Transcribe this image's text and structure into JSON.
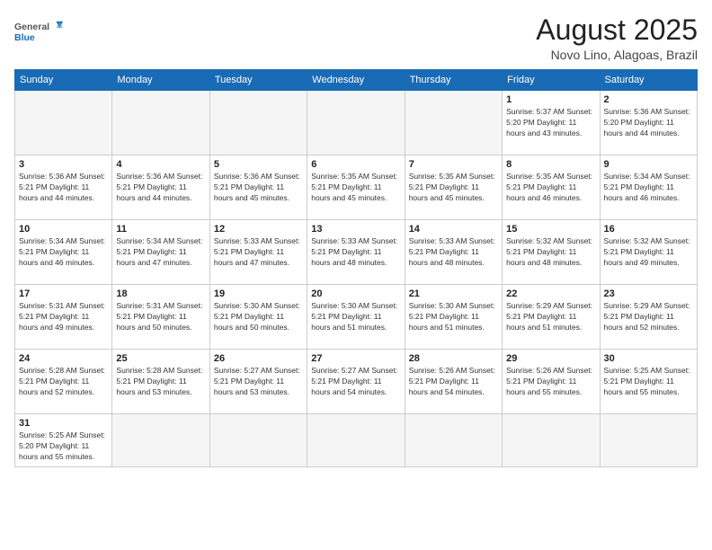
{
  "logo": {
    "text_general": "General",
    "text_blue": "Blue"
  },
  "title": "August 2025",
  "location": "Novo Lino, Alagoas, Brazil",
  "days_of_week": [
    "Sunday",
    "Monday",
    "Tuesday",
    "Wednesday",
    "Thursday",
    "Friday",
    "Saturday"
  ],
  "weeks": [
    [
      {
        "day": "",
        "detail": ""
      },
      {
        "day": "",
        "detail": ""
      },
      {
        "day": "",
        "detail": ""
      },
      {
        "day": "",
        "detail": ""
      },
      {
        "day": "",
        "detail": ""
      },
      {
        "day": "1",
        "detail": "Sunrise: 5:37 AM\nSunset: 5:20 PM\nDaylight: 11 hours\nand 43 minutes."
      },
      {
        "day": "2",
        "detail": "Sunrise: 5:36 AM\nSunset: 5:20 PM\nDaylight: 11 hours\nand 44 minutes."
      }
    ],
    [
      {
        "day": "3",
        "detail": "Sunrise: 5:36 AM\nSunset: 5:21 PM\nDaylight: 11 hours\nand 44 minutes."
      },
      {
        "day": "4",
        "detail": "Sunrise: 5:36 AM\nSunset: 5:21 PM\nDaylight: 11 hours\nand 44 minutes."
      },
      {
        "day": "5",
        "detail": "Sunrise: 5:36 AM\nSunset: 5:21 PM\nDaylight: 11 hours\nand 45 minutes."
      },
      {
        "day": "6",
        "detail": "Sunrise: 5:35 AM\nSunset: 5:21 PM\nDaylight: 11 hours\nand 45 minutes."
      },
      {
        "day": "7",
        "detail": "Sunrise: 5:35 AM\nSunset: 5:21 PM\nDaylight: 11 hours\nand 45 minutes."
      },
      {
        "day": "8",
        "detail": "Sunrise: 5:35 AM\nSunset: 5:21 PM\nDaylight: 11 hours\nand 46 minutes."
      },
      {
        "day": "9",
        "detail": "Sunrise: 5:34 AM\nSunset: 5:21 PM\nDaylight: 11 hours\nand 46 minutes."
      }
    ],
    [
      {
        "day": "10",
        "detail": "Sunrise: 5:34 AM\nSunset: 5:21 PM\nDaylight: 11 hours\nand 46 minutes."
      },
      {
        "day": "11",
        "detail": "Sunrise: 5:34 AM\nSunset: 5:21 PM\nDaylight: 11 hours\nand 47 minutes."
      },
      {
        "day": "12",
        "detail": "Sunrise: 5:33 AM\nSunset: 5:21 PM\nDaylight: 11 hours\nand 47 minutes."
      },
      {
        "day": "13",
        "detail": "Sunrise: 5:33 AM\nSunset: 5:21 PM\nDaylight: 11 hours\nand 48 minutes."
      },
      {
        "day": "14",
        "detail": "Sunrise: 5:33 AM\nSunset: 5:21 PM\nDaylight: 11 hours\nand 48 minutes."
      },
      {
        "day": "15",
        "detail": "Sunrise: 5:32 AM\nSunset: 5:21 PM\nDaylight: 11 hours\nand 48 minutes."
      },
      {
        "day": "16",
        "detail": "Sunrise: 5:32 AM\nSunset: 5:21 PM\nDaylight: 11 hours\nand 49 minutes."
      }
    ],
    [
      {
        "day": "17",
        "detail": "Sunrise: 5:31 AM\nSunset: 5:21 PM\nDaylight: 11 hours\nand 49 minutes."
      },
      {
        "day": "18",
        "detail": "Sunrise: 5:31 AM\nSunset: 5:21 PM\nDaylight: 11 hours\nand 50 minutes."
      },
      {
        "day": "19",
        "detail": "Sunrise: 5:30 AM\nSunset: 5:21 PM\nDaylight: 11 hours\nand 50 minutes."
      },
      {
        "day": "20",
        "detail": "Sunrise: 5:30 AM\nSunset: 5:21 PM\nDaylight: 11 hours\nand 51 minutes."
      },
      {
        "day": "21",
        "detail": "Sunrise: 5:30 AM\nSunset: 5:21 PM\nDaylight: 11 hours\nand 51 minutes."
      },
      {
        "day": "22",
        "detail": "Sunrise: 5:29 AM\nSunset: 5:21 PM\nDaylight: 11 hours\nand 51 minutes."
      },
      {
        "day": "23",
        "detail": "Sunrise: 5:29 AM\nSunset: 5:21 PM\nDaylight: 11 hours\nand 52 minutes."
      }
    ],
    [
      {
        "day": "24",
        "detail": "Sunrise: 5:28 AM\nSunset: 5:21 PM\nDaylight: 11 hours\nand 52 minutes."
      },
      {
        "day": "25",
        "detail": "Sunrise: 5:28 AM\nSunset: 5:21 PM\nDaylight: 11 hours\nand 53 minutes."
      },
      {
        "day": "26",
        "detail": "Sunrise: 5:27 AM\nSunset: 5:21 PM\nDaylight: 11 hours\nand 53 minutes."
      },
      {
        "day": "27",
        "detail": "Sunrise: 5:27 AM\nSunset: 5:21 PM\nDaylight: 11 hours\nand 54 minutes."
      },
      {
        "day": "28",
        "detail": "Sunrise: 5:26 AM\nSunset: 5:21 PM\nDaylight: 11 hours\nand 54 minutes."
      },
      {
        "day": "29",
        "detail": "Sunrise: 5:26 AM\nSunset: 5:21 PM\nDaylight: 11 hours\nand 55 minutes."
      },
      {
        "day": "30",
        "detail": "Sunrise: 5:25 AM\nSunset: 5:21 PM\nDaylight: 11 hours\nand 55 minutes."
      }
    ],
    [
      {
        "day": "31",
        "detail": "Sunrise: 5:25 AM\nSunset: 5:20 PM\nDaylight: 11 hours\nand 55 minutes."
      },
      {
        "day": "",
        "detail": ""
      },
      {
        "day": "",
        "detail": ""
      },
      {
        "day": "",
        "detail": ""
      },
      {
        "day": "",
        "detail": ""
      },
      {
        "day": "",
        "detail": ""
      },
      {
        "day": "",
        "detail": ""
      }
    ]
  ]
}
